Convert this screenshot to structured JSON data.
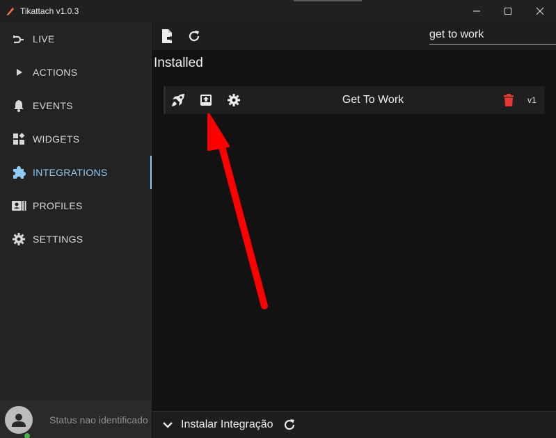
{
  "window": {
    "title": "Tikattach v1.0.3",
    "minimize_icon": "minimize-icon",
    "maximize_icon": "maximize-icon",
    "close_icon": "close-icon"
  },
  "sidebar": {
    "items": [
      {
        "label": "LIVE",
        "icon": "live-plug-icon",
        "active": false
      },
      {
        "label": "ACTIONS",
        "icon": "play-icon",
        "active": false
      },
      {
        "label": "EVENTS",
        "icon": "bell-icon",
        "active": false
      },
      {
        "label": "WIDGETS",
        "icon": "widgets-icon",
        "active": false
      },
      {
        "label": "INTEGRATIONS",
        "icon": "puzzle-icon",
        "active": true
      },
      {
        "label": "PROFILES",
        "icon": "profile-card-icon",
        "active": false
      },
      {
        "label": "SETTINGS",
        "icon": "gear-icon",
        "active": false
      }
    ],
    "status_text": "Status nao identificado",
    "status_color": "#4caf50"
  },
  "toolbar": {
    "import_icon": "file-import-icon",
    "refresh_icon": "refresh-icon",
    "search_value": "get to work"
  },
  "main": {
    "section_title": "Installed",
    "integrations": [
      {
        "name": "Get To Work",
        "version": "v1",
        "icons": [
          "rocket-icon",
          "export-icon",
          "gear-icon",
          "delete-icon"
        ]
      }
    ]
  },
  "bottom": {
    "label": "Instalar Integração",
    "chevron_icon": "chevron-down-icon",
    "refresh_icon": "refresh-icon"
  },
  "colors": {
    "accent": "#90caf9",
    "delete": "#e53935",
    "annotation_arrow": "#ff0000"
  }
}
